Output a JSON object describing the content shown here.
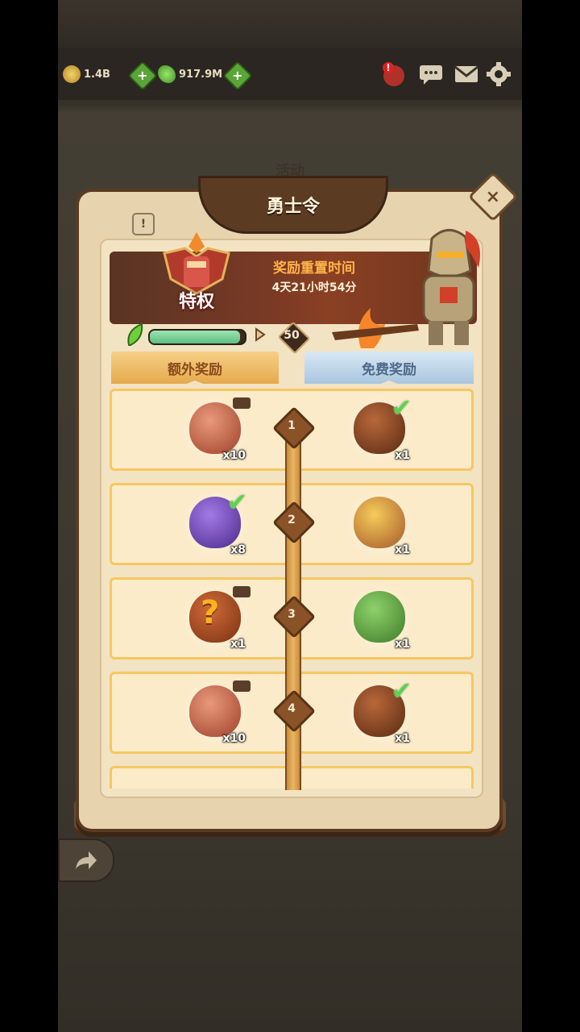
{
  "topbar": {
    "gold": "1.4B",
    "gems": "917.9M"
  },
  "panel": {
    "subtitle": "活动",
    "title": "勇士令",
    "close_label": "×",
    "info_label": "!"
  },
  "banner": {
    "badge_label": "特权",
    "reset_title": "奖励重置时间",
    "reset_time": "4天21小时54分",
    "level": "50",
    "progress_fraction": 0.95
  },
  "tabs": {
    "extra": "额外奖励",
    "free": "免费奖励"
  },
  "rows": [
    {
      "level": "1",
      "extra": {
        "icon": "scroll-sack-icon",
        "qty": "x10",
        "claimed": false,
        "video": true
      },
      "free": {
        "icon": "coffee-bean-icon",
        "qty": "x1",
        "claimed": true
      }
    },
    {
      "level": "2",
      "extra": {
        "icon": "purple-sack-icon",
        "qty": "x8",
        "claimed": true,
        "video": false
      },
      "free": {
        "icon": "gold-sack-icon",
        "qty": "x1",
        "claimed": false
      }
    },
    {
      "level": "3",
      "extra": {
        "icon": "mystery-sack-icon",
        "qty": "x1",
        "claimed": false,
        "video": true
      },
      "free": {
        "icon": "green-gem-sack-icon",
        "qty": "x1",
        "claimed": false
      }
    },
    {
      "level": "4",
      "extra": {
        "icon": "scroll-sack-icon",
        "qty": "x10",
        "claimed": false,
        "video": true
      },
      "free": {
        "icon": "coffee-bean-icon",
        "qty": "x1",
        "claimed": true
      }
    }
  ],
  "colors": {
    "accent_orange": "#ffb34a",
    "check_green": "#5ed24a",
    "row_border": "#f6c761"
  }
}
